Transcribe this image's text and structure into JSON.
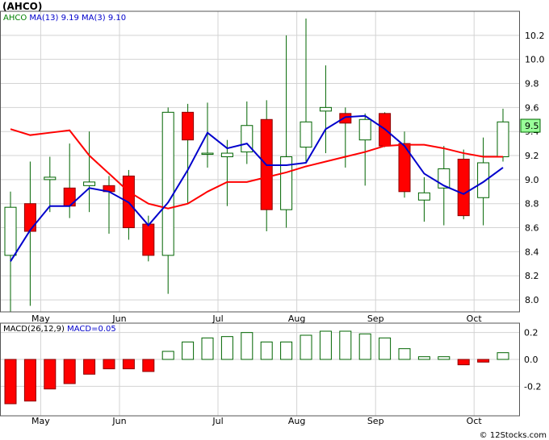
{
  "title": "(AHCO)",
  "watermark": "© 12Stocks.com",
  "price_panel": {
    "legend": [
      {
        "text": "AHCO",
        "color": "#008000"
      },
      {
        "text": "MA(13)",
        "color": "#0000cc"
      },
      {
        "text": "9.19",
        "color": "#0000cc"
      },
      {
        "text": "MA(3)",
        "color": "#0000cc"
      },
      {
        "text": "9.10",
        "color": "#0000cc"
      }
    ],
    "last_price": "9.5"
  },
  "macd_panel": {
    "legend": [
      {
        "text": "MACD(26,12,9)",
        "color": "#000000"
      },
      {
        "text": "MACD=0.05",
        "color": "#0000cc"
      }
    ]
  },
  "chart_data": [
    {
      "type": "candlestick",
      "title": "(AHCO)",
      "ylim": [
        7.9,
        10.4
      ],
      "y_ticks": [
        "8.0",
        "8.2",
        "8.4",
        "8.6",
        "8.8",
        "9.0",
        "9.2",
        "9.4",
        "9.6",
        "9.8",
        "10.0",
        "10.2"
      ],
      "x_ticks": [
        {
          "label": "May",
          "index": 1
        },
        {
          "label": "Jun",
          "index": 5
        },
        {
          "label": "Jul",
          "index": 10
        },
        {
          "label": "Aug",
          "index": 14
        },
        {
          "label": "Sep",
          "index": 18
        },
        {
          "label": "Oct",
          "index": 23
        }
      ],
      "colors": {
        "up_border": "#006400",
        "down_fill": "#ff0000",
        "down_border": "#8b0000",
        "wick": "#006400",
        "ma13": "#ff0000",
        "ma3": "#0000cc",
        "grid": "#d3d3d3",
        "price_tag_bg": "#99ff99"
      },
      "candles": [
        {
          "open": 8.37,
          "close": 8.77,
          "high": 8.9,
          "low": 7.9
        },
        {
          "open": 8.8,
          "close": 8.57,
          "high": 9.15,
          "low": 7.95
        },
        {
          "open": 9.0,
          "close": 9.02,
          "high": 9.19,
          "low": 8.73
        },
        {
          "open": 8.93,
          "close": 8.78,
          "high": 9.3,
          "low": 8.68
        },
        {
          "open": 8.95,
          "close": 8.98,
          "high": 9.4,
          "low": 8.73
        },
        {
          "open": 8.95,
          "close": 8.9,
          "high": 9.03,
          "low": 8.55
        },
        {
          "open": 9.03,
          "close": 8.6,
          "high": 9.08,
          "low": 8.5
        },
        {
          "open": 8.63,
          "close": 8.37,
          "high": 8.7,
          "low": 8.32
        },
        {
          "open": 8.37,
          "close": 9.56,
          "high": 9.6,
          "low": 8.05
        },
        {
          "open": 9.56,
          "close": 9.33,
          "high": 9.63,
          "low": 8.8
        },
        {
          "open": 9.22,
          "close": 9.22,
          "high": 9.64,
          "low": 9.1
        },
        {
          "open": 9.19,
          "close": 9.22,
          "high": 9.33,
          "low": 8.78
        },
        {
          "open": 9.23,
          "close": 9.45,
          "high": 9.65,
          "low": 9.13
        },
        {
          "open": 9.5,
          "close": 8.75,
          "high": 9.66,
          "low": 8.57
        },
        {
          "open": 8.75,
          "close": 9.19,
          "high": 10.2,
          "low": 8.6
        },
        {
          "open": 9.27,
          "close": 9.48,
          "high": 10.34,
          "low": 9.15
        },
        {
          "open": 9.57,
          "close": 9.6,
          "high": 9.95,
          "low": 9.22
        },
        {
          "open": 9.55,
          "close": 9.47,
          "high": 9.6,
          "low": 9.1
        },
        {
          "open": 9.33,
          "close": 9.5,
          "high": 9.55,
          "low": 8.95
        },
        {
          "open": 9.55,
          "close": 9.28,
          "high": 9.56,
          "low": 9.27
        },
        {
          "open": 9.3,
          "close": 8.9,
          "high": 9.4,
          "low": 8.85
        },
        {
          "open": 8.83,
          "close": 8.89,
          "high": 9.02,
          "low": 8.65
        },
        {
          "open": 8.93,
          "close": 9.09,
          "high": 9.28,
          "low": 8.62
        },
        {
          "open": 9.17,
          "close": 8.7,
          "high": 9.25,
          "low": 8.67
        },
        {
          "open": 8.85,
          "close": 9.14,
          "high": 9.35,
          "low": 8.62
        },
        {
          "open": 9.19,
          "close": 9.48,
          "high": 9.59,
          "low": 9.15
        }
      ],
      "series": [
        {
          "name": "MA(13)",
          "start": 0,
          "values": [
            9.42,
            9.37,
            9.39,
            9.41,
            9.2,
            9.05,
            8.9,
            8.8,
            8.76,
            8.8,
            8.9,
            8.98,
            8.98,
            9.02,
            9.06,
            9.11,
            9.15,
            9.19,
            9.23,
            9.28,
            9.29,
            9.29,
            9.26,
            9.22,
            9.19,
            9.19
          ]
        },
        {
          "name": "MA(3)",
          "start": 0,
          "values": [
            8.32,
            8.58,
            8.78,
            8.78,
            8.93,
            8.9,
            8.81,
            8.62,
            8.81,
            9.08,
            9.39,
            9.26,
            9.3,
            9.12,
            9.12,
            9.14,
            9.42,
            9.52,
            9.53,
            9.42,
            9.28,
            9.05,
            8.95,
            8.88,
            8.98,
            9.1
          ]
        }
      ]
    },
    {
      "type": "bar",
      "title": "MACD(26,12,9)",
      "ylim": [
        -0.42,
        0.27
      ],
      "y_ticks": [
        "0.2",
        "0.0",
        "-0.2"
      ],
      "colors": {
        "positive_border": "#006400",
        "negative_fill": "#ff0000",
        "negative_border": "#8b0000"
      },
      "values": [
        -0.33,
        -0.31,
        -0.22,
        -0.18,
        -0.11,
        -0.07,
        -0.07,
        -0.09,
        0.06,
        0.13,
        0.16,
        0.17,
        0.2,
        0.13,
        0.13,
        0.18,
        0.21,
        0.21,
        0.19,
        0.16,
        0.08,
        0.02,
        0.02,
        -0.04,
        -0.02,
        0.05
      ]
    }
  ]
}
